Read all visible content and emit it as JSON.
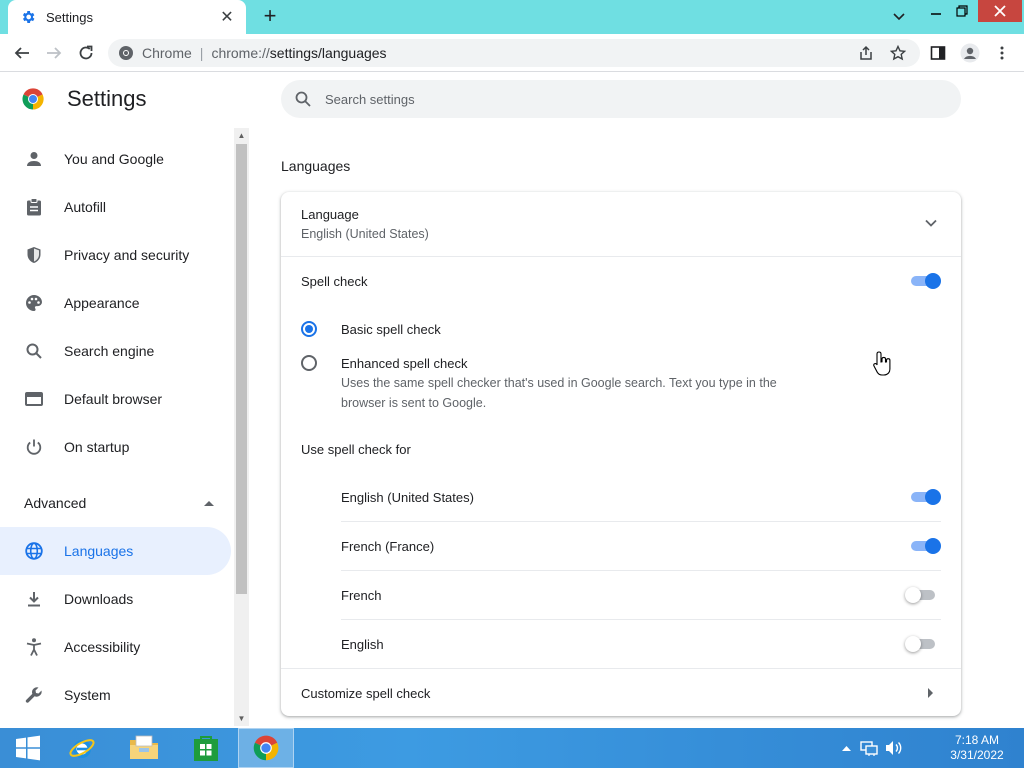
{
  "browser": {
    "tab_title": "Settings",
    "omnibox_site": "Chrome",
    "omnibox_url_prefix": "chrome://",
    "omnibox_url_path": "settings/languages"
  },
  "settings": {
    "title": "Settings",
    "search_placeholder": "Search settings",
    "sidebar": [
      {
        "label": "You and Google",
        "icon": "person-icon"
      },
      {
        "label": "Autofill",
        "icon": "clipboard-icon"
      },
      {
        "label": "Privacy and security",
        "icon": "shield-icon"
      },
      {
        "label": "Appearance",
        "icon": "palette-icon"
      },
      {
        "label": "Search engine",
        "icon": "search-icon"
      },
      {
        "label": "Default browser",
        "icon": "browser-window-icon"
      },
      {
        "label": "On startup",
        "icon": "power-icon"
      }
    ],
    "advanced_label": "Advanced",
    "advanced_items": [
      {
        "label": "Languages",
        "icon": "globe-icon",
        "active": true
      },
      {
        "label": "Downloads",
        "icon": "download-icon"
      },
      {
        "label": "Accessibility",
        "icon": "accessibility-icon"
      },
      {
        "label": "System",
        "icon": "wrench-icon"
      }
    ],
    "section_title": "Languages",
    "language_label": "Language",
    "language_value": "English (United States)",
    "spell_check_label": "Spell check",
    "spell_check_on": true,
    "basic_spell_check": "Basic spell check",
    "enhanced_spell_check": "Enhanced spell check",
    "enhanced_desc_1": "Uses the same spell checker that's used in Google search. Text you type in the",
    "enhanced_desc_2": "browser is sent to Google.",
    "selected_mode": "basic",
    "use_spell_check_for": "Use spell check for",
    "spell_languages": [
      {
        "label": "English (United States)",
        "on": true
      },
      {
        "label": "French (France)",
        "on": true
      },
      {
        "label": "French",
        "on": false
      },
      {
        "label": "English",
        "on": false
      }
    ],
    "customize_label": "Customize spell check"
  },
  "taskbar": {
    "time": "7:18 AM",
    "date": "3/31/2022"
  },
  "colors": {
    "accent": "#1a73e8",
    "titlebar": "#6fdfe2",
    "taskbar": "#3a8ed6"
  }
}
